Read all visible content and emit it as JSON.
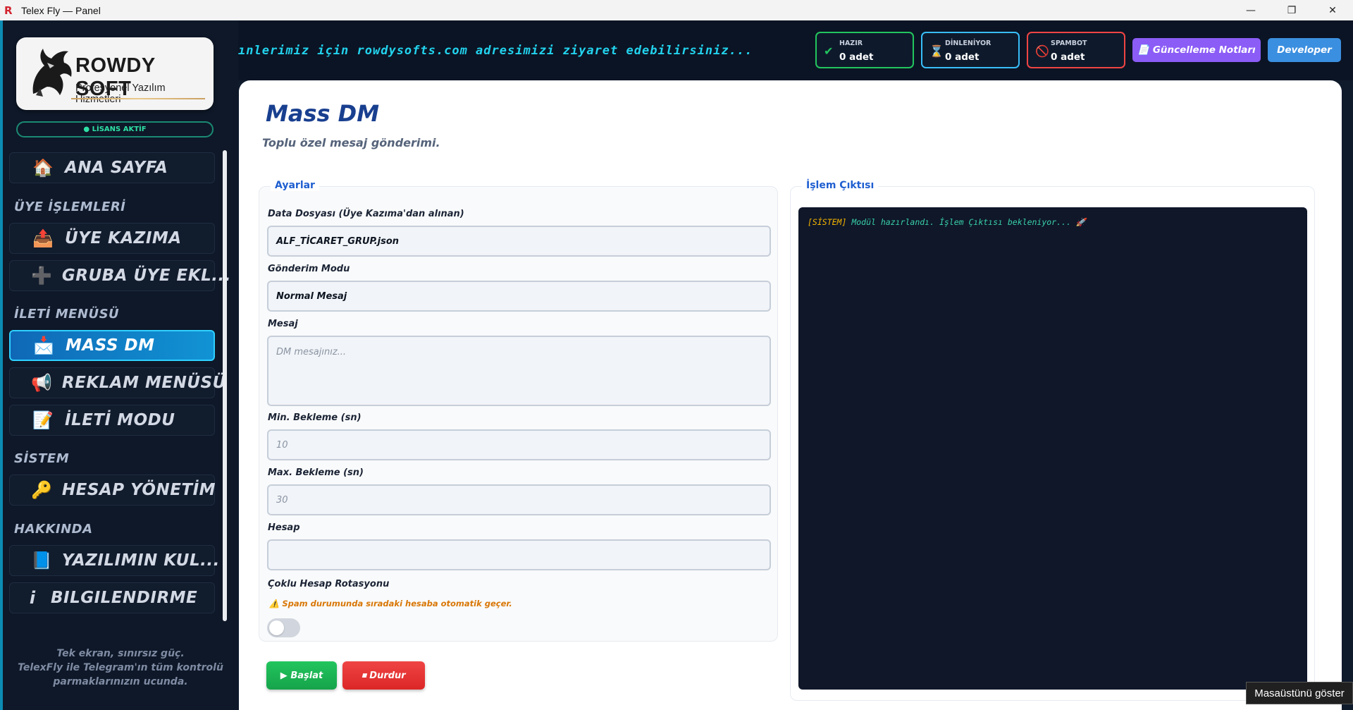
{
  "window": {
    "title": "Telex Fly — Panel",
    "minimize": "—",
    "restore": "❐",
    "close": "✕"
  },
  "sidebar": {
    "logo_title": "ROWDY SOFT",
    "logo_subtitle": "Profesyonel Yazılım Hizmetleri",
    "license": "● LİSANS AKTİF",
    "items": [
      {
        "label": "ANA SAYFA",
        "icon": "🏠"
      },
      {
        "label": "ÜYE KAZIMA",
        "icon": "📤"
      },
      {
        "label": "GRUBA ÜYE EKL...",
        "icon": "➕"
      },
      {
        "label": "MASS DM",
        "icon": "📩"
      },
      {
        "label": "REKLAM MENÜSÜ",
        "icon": "📢"
      },
      {
        "label": "İLETİ MODU",
        "icon": "📝"
      },
      {
        "label": "HESAP YÖNETİM",
        "icon": "🔑"
      },
      {
        "label": "YAZILIMIN KUL...",
        "icon": "📘"
      },
      {
        "label": "BILGILENDIRME",
        "icon": "i"
      }
    ],
    "sections": [
      "ÜYE İŞLEMLERİ",
      "İLETİ MENÜSÜ",
      "SİSTEM",
      "HAKKINDA"
    ],
    "footer": [
      "Tek ekran, sınırsız güç.",
      "TelexFly ile Telegram'ın tüm kontrolü",
      "parmaklarınızın ucunda."
    ]
  },
  "topbar": {
    "marquee": "ınlerimiz için rowdysofts.com adresimizi ziyaret edebilirsiniz...",
    "stats": [
      {
        "title": "HAZIR",
        "value": "0 adet",
        "icon": "✔",
        "color": "#22c55e"
      },
      {
        "title": "DİNLENİYOR",
        "value": "0 adet",
        "icon": "⌛",
        "color": "#38bdf8"
      },
      {
        "title": "SPAMBOT",
        "value": "0 adet",
        "icon": "🚫",
        "color": "#ef4444"
      }
    ],
    "notes_button": "📄 Güncelleme Notları",
    "developer_button": "Developer"
  },
  "main": {
    "title": "Mass DM",
    "subtitle": "Toplu özel mesaj gönderimi.",
    "settings": {
      "legend": "Ayarlar",
      "data_file_label": "Data Dosyası (Üye Kazıma'dan alınan)",
      "data_file_value": "ALF_TİCARET_GRUP.json",
      "mode_label": "Gönderim Modu",
      "mode_value": "Normal Mesaj",
      "message_label": "Mesaj",
      "message_placeholder": "DM mesajınız...",
      "min_wait_label": "Min. Bekleme (sn)",
      "min_wait_placeholder": "10",
      "max_wait_label": "Max. Bekleme (sn)",
      "max_wait_placeholder": "30",
      "account_label": "Hesap",
      "account_value": "",
      "rotation_label": "Çoklu Hesap Rotasyonu",
      "rotation_warning": "⚠️ Spam durumunda sıradaki hesaba otomatik geçer.",
      "rotation_enabled": false
    },
    "start_button": "▶ Başlat",
    "stop_button": "⏹ Durdur",
    "output": {
      "legend": "İşlem Çıktısı",
      "line_tag": "[SİSTEM]",
      "line_text": " Modül hazırlandı. İşlem Çıktısı bekleniyor... 🚀"
    }
  },
  "tooltip": "Masaüstünü göster"
}
